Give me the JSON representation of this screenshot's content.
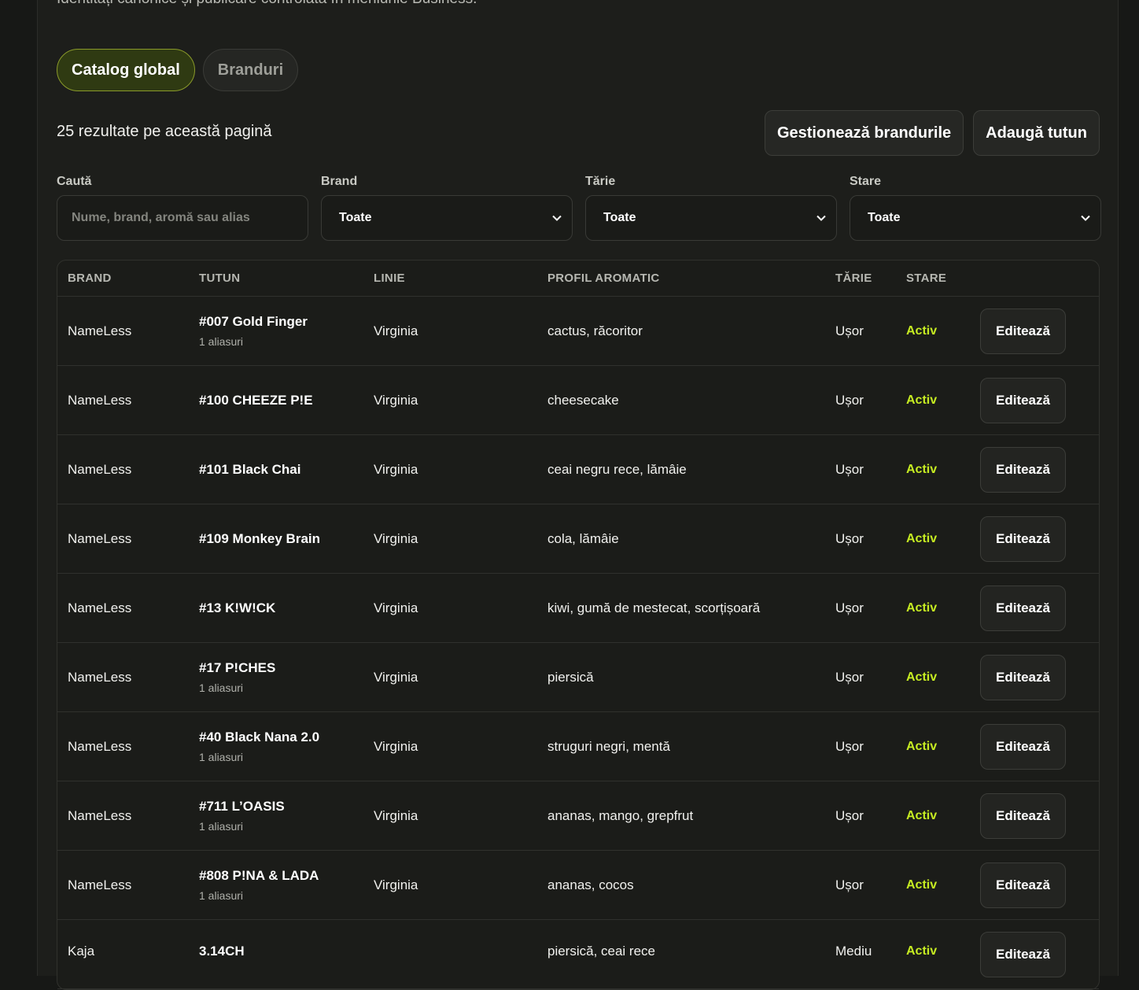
{
  "header": {
    "subtitle": "Identități canonice și publicare controlată în meniurile Business."
  },
  "tabs": [
    {
      "label": "Catalog global",
      "active": true
    },
    {
      "label": "Branduri",
      "active": false
    }
  ],
  "results_text": "25 rezultate pe această pagină",
  "actions": {
    "manage_brands": "Gestionează brandurile",
    "add_tobacco": "Adaugă tutun"
  },
  "filters": {
    "search": {
      "label": "Caută",
      "placeholder": "Nume, brand, aromă sau alias",
      "value": ""
    },
    "brand": {
      "label": "Brand",
      "value": "Toate"
    },
    "strength": {
      "label": "Tărie",
      "value": "Toate"
    },
    "state": {
      "label": "Stare",
      "value": "Toate"
    }
  },
  "table": {
    "columns": [
      "BRAND",
      "TUTUN",
      "LINIE",
      "PROFIL AROMATIC",
      "TĂRIE",
      "STARE"
    ],
    "edit_label": "Editează",
    "rows": [
      {
        "brand": "NameLess",
        "name": "#007 Gold Finger",
        "aliases": "1 aliasuri",
        "line": "Virginia",
        "profile": "cactus, răcoritor",
        "strength": "Ușor",
        "state": "Activ"
      },
      {
        "brand": "NameLess",
        "name": "#100 CHEEZE P!E",
        "aliases": "",
        "line": "Virginia",
        "profile": "cheesecake",
        "strength": "Ușor",
        "state": "Activ"
      },
      {
        "brand": "NameLess",
        "name": "#101 Black Chai",
        "aliases": "",
        "line": "Virginia",
        "profile": "ceai negru rece, lămâie",
        "strength": "Ușor",
        "state": "Activ"
      },
      {
        "brand": "NameLess",
        "name": "#109 Monkey Brain",
        "aliases": "",
        "line": "Virginia",
        "profile": "cola, lămâie",
        "strength": "Ușor",
        "state": "Activ"
      },
      {
        "brand": "NameLess",
        "name": "#13 K!W!CK",
        "aliases": "",
        "line": "Virginia",
        "profile": "kiwi, gumă de mestecat, scorțișoară",
        "strength": "Ușor",
        "state": "Activ"
      },
      {
        "brand": "NameLess",
        "name": "#17 P!CHES",
        "aliases": "1 aliasuri",
        "line": "Virginia",
        "profile": "piersică",
        "strength": "Ușor",
        "state": "Activ"
      },
      {
        "brand": "NameLess",
        "name": "#40 Black Nana 2.0",
        "aliases": "1 aliasuri",
        "line": "Virginia",
        "profile": "struguri negri, mentă",
        "strength": "Ușor",
        "state": "Activ"
      },
      {
        "brand": "NameLess",
        "name": "#711 L’OASIS",
        "aliases": "1 aliasuri",
        "line": "Virginia",
        "profile": "ananas, mango, grepfrut",
        "strength": "Ușor",
        "state": "Activ"
      },
      {
        "brand": "NameLess",
        "name": "#808 P!NA & LADA",
        "aliases": "1 aliasuri",
        "line": "Virginia",
        "profile": "ananas, cocos",
        "strength": "Ușor",
        "state": "Activ"
      },
      {
        "brand": "Kaja",
        "name": "3.14CH",
        "aliases": "",
        "line": "",
        "profile": "piersică, ceai rece",
        "strength": "Mediu",
        "state": "Activ"
      }
    ]
  }
}
